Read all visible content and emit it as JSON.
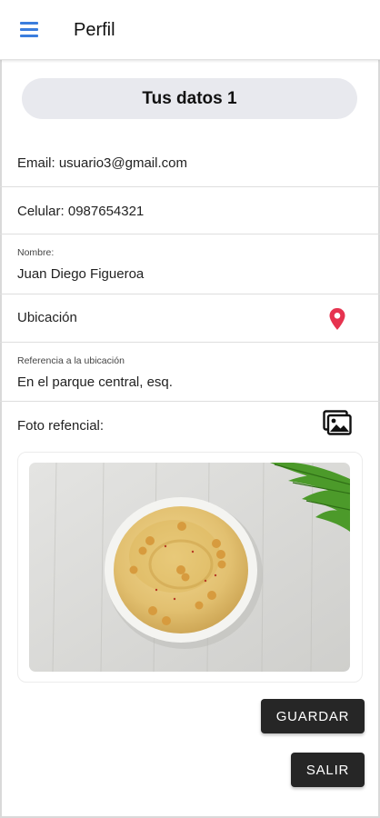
{
  "toolbar": {
    "title": "Perfil",
    "menu_icon": "hamburger-menu-icon"
  },
  "header": {
    "title": "Tus datos 1"
  },
  "profile": {
    "email": "Email: usuario3@gmail.com",
    "phone": "Celular: 0987654321",
    "name_label": "Nombre:",
    "name_value": "Juan Diego Figueroa",
    "location_label": "Ubicación",
    "location_icon": "map-pin-icon",
    "reference_label": "Referencia a la ubicación",
    "reference_value": "En el parque central, esq.",
    "photo_label": "Foto refencial:",
    "photo_icon": "image-gallery-icon"
  },
  "actions": {
    "save_label": "GUARDAR",
    "exit_label": "SALIR"
  },
  "colors": {
    "accent": "#3b7ddd",
    "pin": "#e6334f",
    "button_bg": "#262626",
    "pill_bg": "#e8e9ee"
  }
}
